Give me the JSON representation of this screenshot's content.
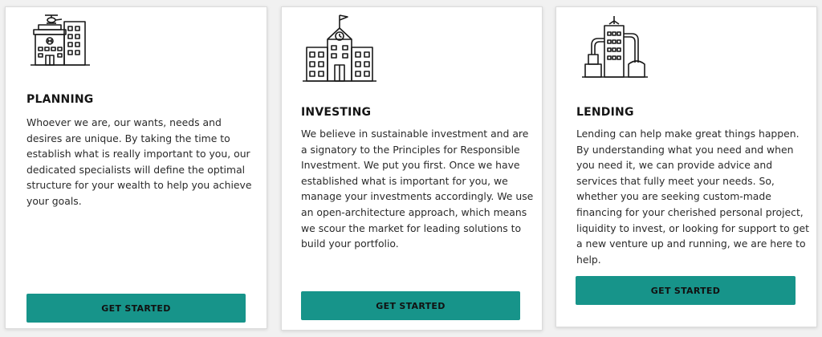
{
  "accent_color": "#17948a",
  "cards": [
    {
      "icon": "hospital-building-icon",
      "title": "PLANNING",
      "body": "Whoever we are, our wants, needs and desires are unique. By taking the time to establish what is really important to you, our dedicated specialists will define the optimal structure for your wealth to help you achieve your goals.",
      "button": "GET STARTED"
    },
    {
      "icon": "school-building-icon",
      "title": "INVESTING",
      "body": "We believe in sustainable investment and are a signatory to the Principles for Responsible Investment. We put you first. Once we have established what is important for you, we manage your investments accordingly. We use an open-architecture approach, which means we scour the market for leading solutions to build your portfolio.",
      "button": "GET STARTED"
    },
    {
      "icon": "factory-building-icon",
      "title": "LENDING",
      "body": "Lending can help make great things happen. By understanding what you need and when you need it, we can provide advice and services that fully meet your needs. So, whether you are seeking custom-made financing for your cherished personal project, liquidity to invest, or looking for support to get a new venture up and running, we are here to help.",
      "button": "GET STARTED"
    }
  ]
}
